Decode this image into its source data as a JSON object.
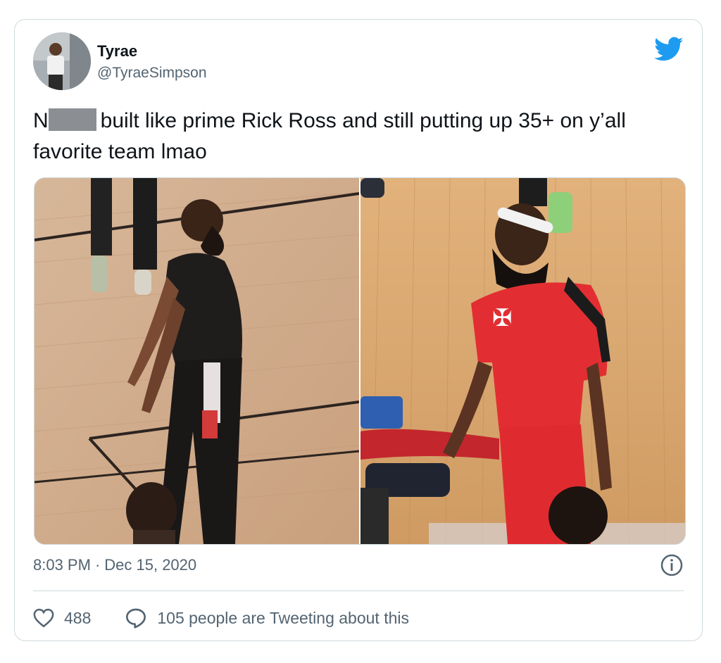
{
  "tweet": {
    "author": {
      "display_name": "Tyrae",
      "handle": "@TyraeSimpson"
    },
    "text_before_redaction": "N",
    "text_after_redaction": "built like prime Rick Ross and still putting up 35+ on y’all favorite team lmao",
    "timestamp": {
      "time": "8:03 PM",
      "separator": "·",
      "date": "Dec 15, 2020"
    },
    "likes": "488",
    "conversation": "105 people are Tweeting about this"
  },
  "icons": {
    "brand": "twitter-bird-icon",
    "info": "info-icon",
    "like": "heart-icon",
    "reply": "speech-bubble-icon"
  },
  "colors": {
    "twitter_blue": "#1d9bf0",
    "secondary_text": "#536471",
    "border": "#cfd9de",
    "rockets_red": "#e0202d"
  }
}
